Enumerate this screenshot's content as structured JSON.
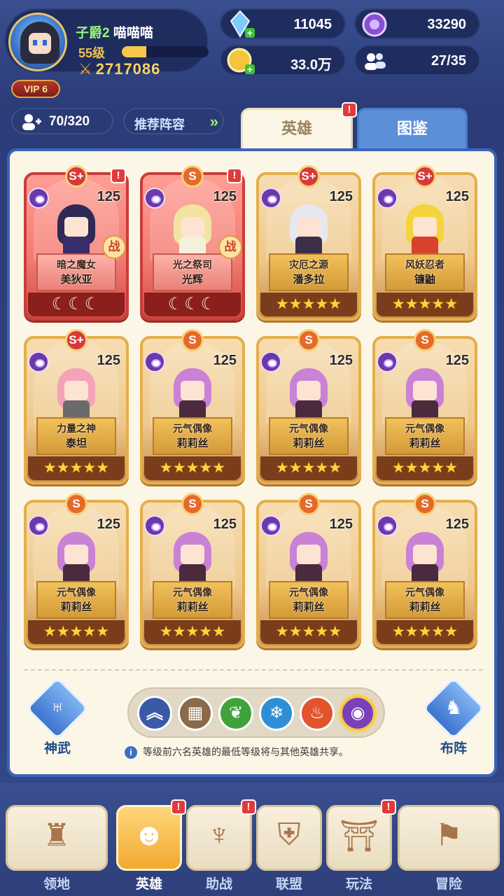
{
  "player": {
    "rank": "子爵2",
    "name": "喵喵喵",
    "level": "55级",
    "exp_fraction": 0.28,
    "power": "2717086",
    "vip": "VIP 6"
  },
  "resources": {
    "diamonds": "11045",
    "purple_gems": "33290",
    "gold": "33.0万",
    "members": "27/35"
  },
  "toolbar": {
    "hero_count": "70/320",
    "recommend_label": "推荐阵容",
    "recommend_arrows": "»"
  },
  "tabs": [
    {
      "label": "英雄",
      "active": true,
      "alert": "!"
    },
    {
      "label": "图鉴",
      "active": false
    }
  ],
  "heroes": [
    {
      "grade": "S+",
      "level": "125",
      "title": "暗之魔女",
      "name": "美狄亚",
      "style": "red",
      "bottom": "☾☾☾",
      "battle": "战",
      "alert": "!",
      "hair": "#2f2a55",
      "body": "#3a2d6b"
    },
    {
      "grade": "S",
      "level": "125",
      "title": "光之祭司",
      "name": "光辉",
      "style": "red",
      "bottom": "☾☾☾",
      "battle": "战",
      "alert": "!",
      "hair": "#f3e3a0",
      "body": "#f5f0dc"
    },
    {
      "grade": "S+",
      "level": "125",
      "title": "灾厄之源",
      "name": "潘多拉",
      "style": "gold",
      "bottom": "★★★★★",
      "hair": "#e7e7ef",
      "body": "#3b3047"
    },
    {
      "grade": "S+",
      "level": "125",
      "title": "风妖忍者",
      "name": "镰鼬",
      "style": "gold",
      "bottom": "★★★★★",
      "hair": "#f4d43c",
      "body": "#d9412f"
    },
    {
      "grade": "S+",
      "level": "125",
      "title": "力量之神",
      "name": "泰坦",
      "style": "gold",
      "bottom": "★★★★★",
      "hair": "#f4a3b8",
      "body": "#6b6b6b"
    },
    {
      "grade": "S",
      "level": "125",
      "title": "元气偶像",
      "name": "莉莉丝",
      "style": "gold",
      "bottom": "★★★★★",
      "hair": "#c982d6",
      "body": "#4a2a3c"
    },
    {
      "grade": "S",
      "level": "125",
      "title": "元气偶像",
      "name": "莉莉丝",
      "style": "gold",
      "bottom": "★★★★★",
      "hair": "#c982d6",
      "body": "#4a2a3c"
    },
    {
      "grade": "S",
      "level": "125",
      "title": "元气偶像",
      "name": "莉莉丝",
      "style": "gold",
      "bottom": "★★★★★",
      "hair": "#c982d6",
      "body": "#4a2a3c"
    },
    {
      "grade": "S",
      "level": "125",
      "title": "元气偶像",
      "name": "莉莉丝",
      "style": "gold",
      "bottom": "★★★★★",
      "hair": "#c982d6",
      "body": "#4a2a3c"
    },
    {
      "grade": "S",
      "level": "125",
      "title": "元气偶像",
      "name": "莉莉丝",
      "style": "gold",
      "bottom": "★★★★★",
      "hair": "#c982d6",
      "body": "#4a2a3c"
    },
    {
      "grade": "S",
      "level": "125",
      "title": "元气偶像",
      "name": "莉莉丝",
      "style": "gold",
      "bottom": "★★★★★",
      "hair": "#c982d6",
      "body": "#4a2a3c"
    },
    {
      "grade": "S",
      "level": "125",
      "title": "元气偶像",
      "name": "莉莉丝",
      "style": "gold",
      "bottom": "★★★★★",
      "hair": "#c982d6",
      "body": "#4a2a3c"
    }
  ],
  "side_buttons": {
    "left_label": "神武",
    "right_label": "布阵"
  },
  "filters": [
    {
      "icon": "chevron-up-icon",
      "glyph": "︽",
      "color": "#3a5aa8"
    },
    {
      "icon": "grid-icon",
      "glyph": "▦",
      "color": "#8a6a4a"
    },
    {
      "icon": "leaf-icon",
      "glyph": "❦",
      "color": "#3fa33a"
    },
    {
      "icon": "snowflake-icon",
      "glyph": "❄",
      "color": "#2f8fd6"
    },
    {
      "icon": "fire-icon",
      "glyph": "♨",
      "color": "#e2542b"
    },
    {
      "icon": "eye-icon",
      "glyph": "◉",
      "color": "#7b3fb8",
      "active": true
    }
  ],
  "note": "等级前六名英雄的最低等级将与其他英雄共享。",
  "nav": [
    {
      "label": "领地",
      "glyph": "♜",
      "active": false,
      "alert": ""
    },
    {
      "label": "英雄",
      "glyph": "☻",
      "active": true,
      "alert": "!"
    },
    {
      "label": "助战",
      "glyph": "♆",
      "active": false,
      "alert": "!"
    },
    {
      "label": "联盟",
      "glyph": "⛨",
      "active": false,
      "alert": ""
    },
    {
      "label": "玩法",
      "glyph": "⛩",
      "active": false,
      "alert": "!"
    },
    {
      "label": "冒险",
      "glyph": "⚑",
      "active": false,
      "alert": ""
    }
  ]
}
